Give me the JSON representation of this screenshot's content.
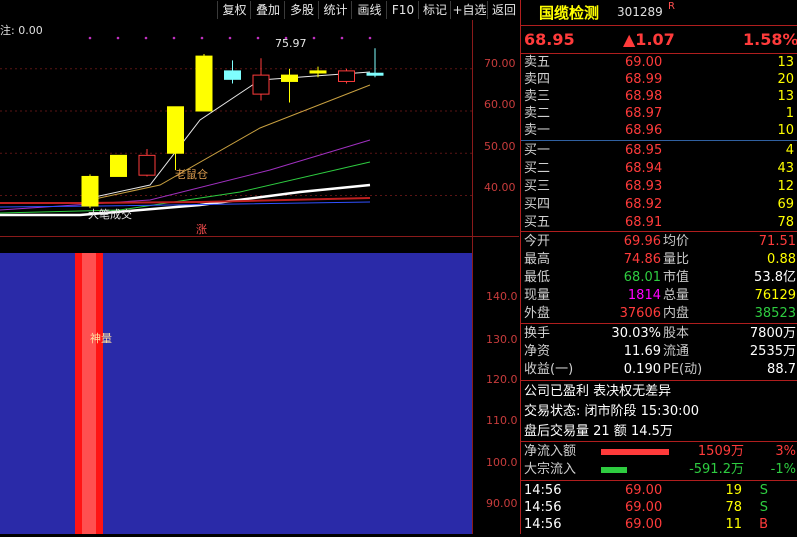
{
  "toolbar": {
    "items": [
      "复权",
      "叠加",
      "多股",
      "统计",
      "画线",
      "F10",
      "标记",
      "+自选",
      "返回"
    ]
  },
  "chart": {
    "top_left_text": "注: 0.00",
    "high_marker": "75.97",
    "ma_label": "老鼠仓",
    "bottom_label": "大笔成交",
    "center_label": "涨",
    "volume_label": "神量",
    "top_axis": [
      "70.00",
      "60.00",
      "50.00",
      "40.00"
    ],
    "bottom_axis": [
      "140.0",
      "130.0",
      "120.0",
      "110.0",
      "100.0",
      "90.00"
    ]
  },
  "chart_data": {
    "type": "candlestick",
    "candles": [
      {
        "open": 37.5,
        "close": 44.5,
        "low": 37.0,
        "high": 45.0
      },
      {
        "open": 44.5,
        "close": 49.5,
        "low": 44.5,
        "high": 49.5
      },
      {
        "open": 49.5,
        "close": 44.8,
        "low": 44.5,
        "high": 51.0
      },
      {
        "open": 50.0,
        "close": 61.0,
        "low": 46.0,
        "high": 61.0
      },
      {
        "open": 60.0,
        "close": 73.0,
        "low": 60.0,
        "high": 73.5
      },
      {
        "open": 69.5,
        "close": 67.5,
        "low": 66.5,
        "high": 72.0
      },
      {
        "open": 68.5,
        "close": 64.0,
        "low": 62.5,
        "high": 72.5
      },
      {
        "open": 67.0,
        "close": 68.5,
        "low": 62.0,
        "high": 70.0
      },
      {
        "open": 69.0,
        "close": 69.5,
        "low": 68.0,
        "high": 70.5
      },
      {
        "open": 69.5,
        "close": 67.0,
        "low": 66.5,
        "high": 70.0
      },
      {
        "open": 68.5,
        "close": 68.95,
        "low": 68.0,
        "high": 74.86
      }
    ],
    "ylim": [
      33,
      78
    ]
  },
  "quote": {
    "name": "国缆检测",
    "code": "301289",
    "badge": "R",
    "price": "68.95",
    "change": "▲1.07",
    "change_pct": "1.58%",
    "sells": [
      {
        "label": "卖五",
        "price": "69.00",
        "vol": "13"
      },
      {
        "label": "卖四",
        "price": "68.99",
        "vol": "20"
      },
      {
        "label": "卖三",
        "price": "68.98",
        "vol": "13"
      },
      {
        "label": "卖二",
        "price": "68.97",
        "vol": "1"
      },
      {
        "label": "卖一",
        "price": "68.96",
        "vol": "10"
      }
    ],
    "buys": [
      {
        "label": "买一",
        "price": "68.95",
        "vol": "4"
      },
      {
        "label": "买二",
        "price": "68.94",
        "vol": "43"
      },
      {
        "label": "买三",
        "price": "68.93",
        "vol": "12"
      },
      {
        "label": "买四",
        "price": "68.92",
        "vol": "69"
      },
      {
        "label": "买五",
        "price": "68.91",
        "vol": "78"
      }
    ],
    "stats": [
      {
        "l1": "今开",
        "v1": "69.96",
        "l2": "均价",
        "v2": "71.51"
      },
      {
        "l1": "最高",
        "v1": "74.86",
        "l2": "量比",
        "v2": "0.88"
      },
      {
        "l1": "最低",
        "v1": "68.01",
        "l2": "市值",
        "v2": "53.8亿"
      },
      {
        "l1": "现量",
        "v1": "1814",
        "l2": "总量",
        "v2": "76129"
      },
      {
        "l1": "外盘",
        "v1": "37606",
        "l2": "内盘",
        "v2": "38523"
      }
    ],
    "stats2": [
      {
        "l1": "换手",
        "v1": "30.03%",
        "l2": "股本",
        "v2": "7800万"
      },
      {
        "l1": "净资",
        "v1": "11.69",
        "l2": "流通",
        "v2": "2535万"
      },
      {
        "l1": "收益(一)",
        "v1": "0.190",
        "l2": "PE(动)",
        "v2": "88.7"
      }
    ],
    "info_line": "公司已盈利 表决权无差异",
    "trade_status": "交易状态: 闭市阶段 15:30:00",
    "after_hours": "盘后交易量 21 额 14.5万",
    "flows": [
      {
        "label": "净流入额",
        "value": "1509万",
        "pct": "3%",
        "color": "#ff3b3b"
      },
      {
        "label": "大宗流入",
        "value": "-591.2万",
        "pct": "-1%",
        "color": "#2ecc40"
      }
    ],
    "ticks": [
      {
        "time": "14:56",
        "price": "69.00",
        "vol": "19",
        "side": "S"
      },
      {
        "time": "14:56",
        "price": "69.00",
        "vol": "78",
        "side": "S"
      },
      {
        "time": "14:56",
        "price": "69.00",
        "vol": "11",
        "side": "B"
      }
    ]
  }
}
